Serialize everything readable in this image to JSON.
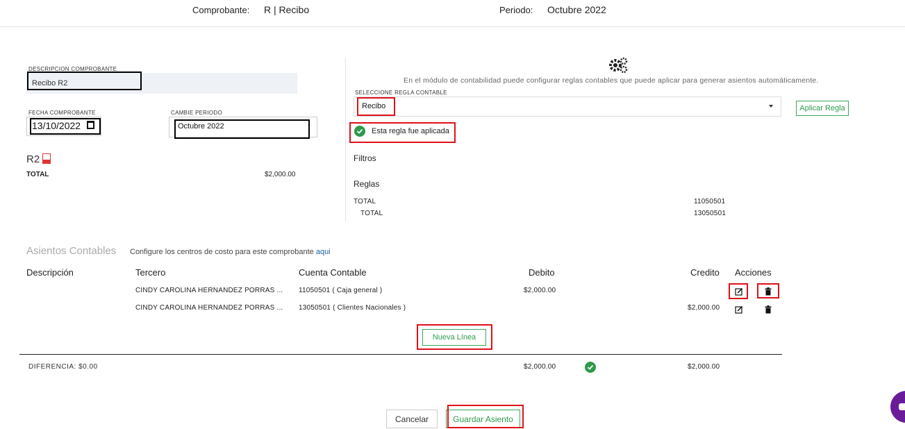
{
  "header": {
    "comprobante_label": "Comprobante:",
    "comprobante_value": "R | Recibo",
    "periodo_label": "Periodo:",
    "periodo_value": "Octubre 2022"
  },
  "form": {
    "descripcion_label": "DESCRIPCION COMPROBANTE",
    "descripcion_value": "Recibo R2",
    "fecha_label": "FECHA COMPROBANTE",
    "fecha_value": "13/10/2022",
    "cambie_periodo_label": "CAMBIE PERIODO",
    "cambie_periodo_value": "Octubre 2022"
  },
  "doc": {
    "code": "R2",
    "total_label": "TOTAL",
    "total_value": "$2,000.00"
  },
  "rules": {
    "info_text": "En el módulo de contabilidad puede configurar reglas contables que puede aplicar para generar asientos automáticamente.",
    "select_label": "SELECCIONE REGLA CONTABLE",
    "select_value": "Recibo",
    "apply_button": "Aplicar Regla",
    "applied_text": "Esta regla fue aplicada",
    "filtros_title": "Filtros",
    "reglas_title": "Reglas",
    "reglas_rows": [
      {
        "label": "TOTAL",
        "account": "11050501"
      },
      {
        "label": "TOTAL",
        "account": "13050501"
      }
    ]
  },
  "asientos": {
    "title": "Asientos Contables",
    "subtitle": "Configure los centros de costo para este comprobante",
    "link": "aqui",
    "columns": {
      "descripcion": "Descripción",
      "tercero": "Tercero",
      "cuenta": "Cuenta Contable",
      "debito": "Debito",
      "credito": "Credito",
      "acciones": "Acciones"
    },
    "rows": [
      {
        "tercero": "CINDY CAROLINA HERNANDEZ PORRAS ...",
        "cuenta": "11050501 ( Caja general )",
        "debito": "$2,000.00",
        "credito": ""
      },
      {
        "tercero": "CINDY CAROLINA HERNANDEZ PORRAS ...",
        "cuenta": "13050501 ( Clientes Nacionales )",
        "debito": "",
        "credito": "$2,000.00"
      }
    ],
    "nueva_linea": "Nueva Línea",
    "diferencia_label": "DIFERENCIA:",
    "diferencia_value": "$0.00",
    "total_debito": "$2,000.00",
    "total_credito": "$2,000.00"
  },
  "footer": {
    "cancel": "Cancelar",
    "save": "Guardar Asiento"
  },
  "colors": {
    "accent_green": "#2e9a4c",
    "highlight_red": "#e0101a",
    "chat_purple": "#6a1b9a"
  },
  "icons": {
    "gears": "gears-icon",
    "calendar": "calendar-icon",
    "pdf": "pdf-icon",
    "check": "check-circle-icon",
    "edit": "edit-icon",
    "delete": "trash-icon",
    "chat": "chat-icon"
  }
}
